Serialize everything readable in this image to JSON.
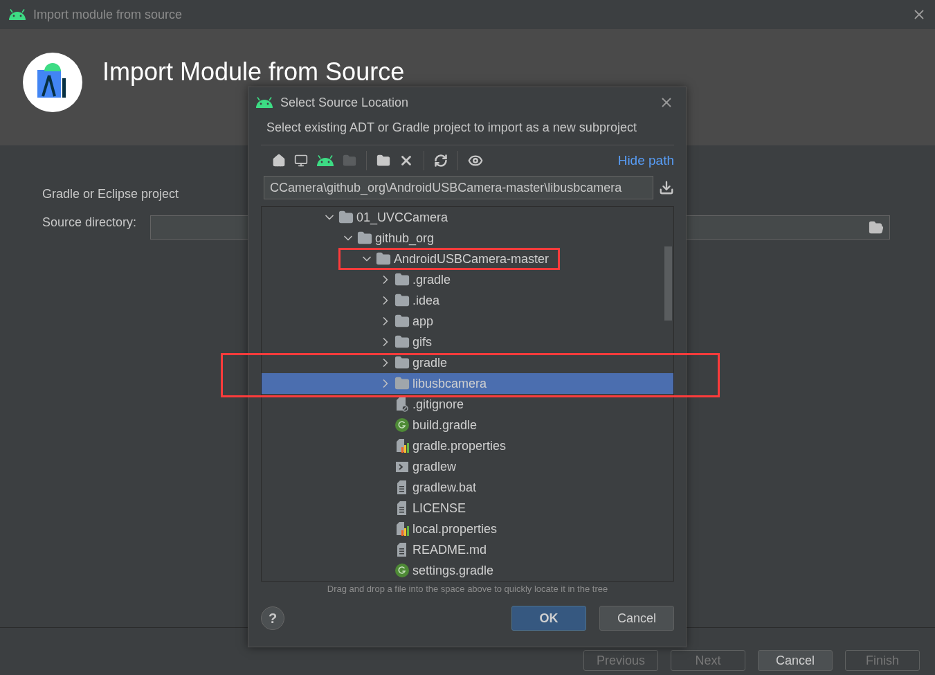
{
  "window": {
    "title": "Import module from source"
  },
  "header": {
    "title": "Import Module from Source"
  },
  "form": {
    "section_label": "Gradle or Eclipse project",
    "source_label": "Source directory:"
  },
  "footer_buttons": [
    {
      "label": "Previous",
      "disabled": true
    },
    {
      "label": "Next",
      "disabled": true
    },
    {
      "label": "Cancel",
      "disabled": false
    },
    {
      "label": "Finish",
      "disabled": true
    }
  ],
  "dialog": {
    "title": "Select Source Location",
    "description": "Select existing ADT or Gradle project to import as a new subproject",
    "toolbar_groups": [
      [
        {
          "kind": "home",
          "disabled": false
        },
        {
          "kind": "desktop",
          "disabled": false
        },
        {
          "kind": "android",
          "disabled": false
        },
        {
          "kind": "project",
          "disabled": true
        }
      ],
      [
        {
          "kind": "new-folder",
          "disabled": false
        },
        {
          "kind": "delete",
          "disabled": false
        }
      ],
      [
        {
          "kind": "refresh",
          "disabled": false
        }
      ],
      [
        {
          "kind": "show-hidden",
          "disabled": false
        }
      ]
    ],
    "hide_path_link": "Hide path",
    "path": "CCamera\\github_org\\AndroidUSBCamera-master\\libusbcamera",
    "tree": [
      {
        "name": "01_UVCCamera",
        "kind": "folder",
        "expanded": true,
        "selected": false,
        "children": [
          {
            "name": "github_org",
            "kind": "folder",
            "expanded": true,
            "selected": false,
            "children": [
              {
                "name": "AndroidUSBCamera-master",
                "kind": "folder",
                "expanded": true,
                "selected": false,
                "highlighted": true,
                "children": [
                  {
                    "name": ".gradle",
                    "kind": "folder",
                    "expanded": false,
                    "selected": false
                  },
                  {
                    "name": ".idea",
                    "kind": "folder",
                    "expanded": false,
                    "selected": false
                  },
                  {
                    "name": "app",
                    "kind": "folder",
                    "expanded": false,
                    "selected": false
                  },
                  {
                    "name": "gifs",
                    "kind": "folder",
                    "expanded": false,
                    "selected": false
                  },
                  {
                    "name": "gradle",
                    "kind": "folder",
                    "expanded": false,
                    "selected": false
                  },
                  {
                    "name": "libusbcamera",
                    "kind": "folder",
                    "expanded": false,
                    "selected": true,
                    "highlighted": true
                  },
                  {
                    "name": ".gitignore",
                    "kind": "ignore",
                    "selected": false
                  },
                  {
                    "name": "build.gradle",
                    "kind": "gradle",
                    "selected": false
                  },
                  {
                    "name": "gradle.properties",
                    "kind": "properties",
                    "selected": false
                  },
                  {
                    "name": "gradlew",
                    "kind": "script",
                    "selected": false
                  },
                  {
                    "name": "gradlew.bat",
                    "kind": "text",
                    "selected": false
                  },
                  {
                    "name": "LICENSE",
                    "kind": "text",
                    "selected": false
                  },
                  {
                    "name": "local.properties",
                    "kind": "properties",
                    "selected": false
                  },
                  {
                    "name": "README.md",
                    "kind": "text",
                    "selected": false
                  },
                  {
                    "name": "settings.gradle",
                    "kind": "gradle",
                    "selected": false
                  }
                ]
              }
            ]
          }
        ]
      }
    ],
    "hint": "Drag and drop a file into the space above to quickly locate it in the tree",
    "help_label": "?",
    "buttons": [
      {
        "label": "OK",
        "default": true
      },
      {
        "label": "Cancel",
        "default": false
      }
    ]
  }
}
